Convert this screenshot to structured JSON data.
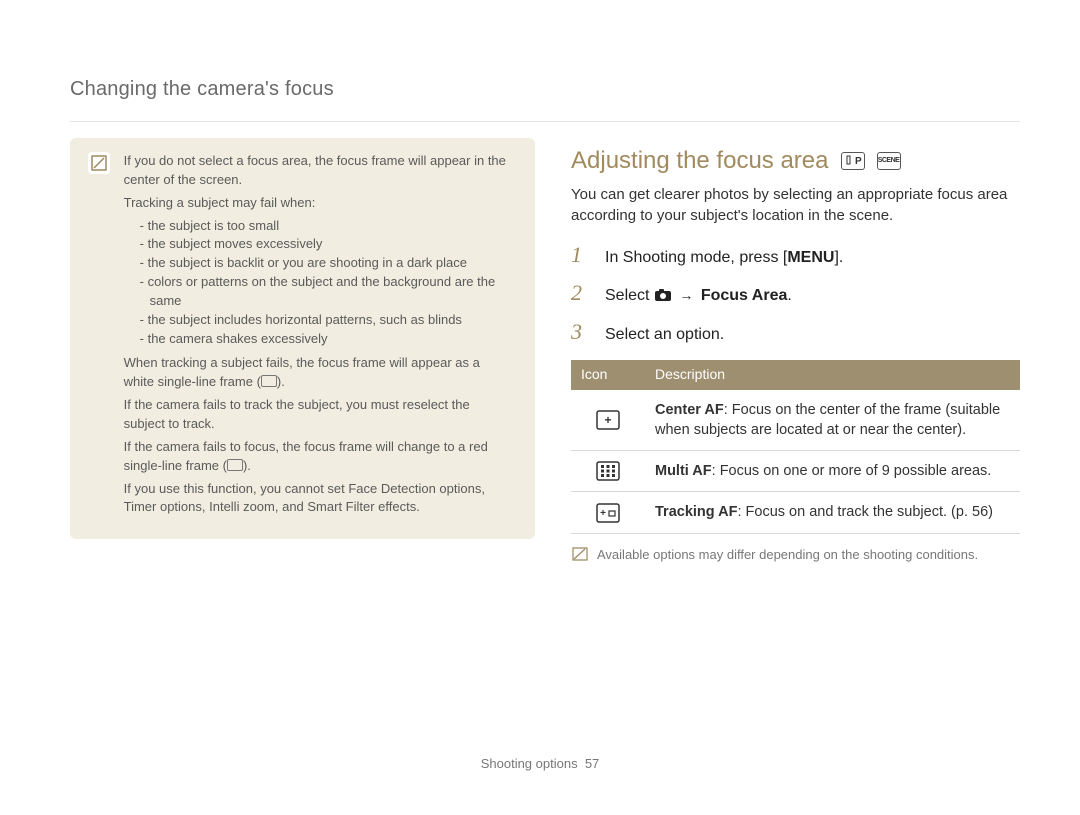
{
  "section_title": "Changing the camera's focus",
  "note": {
    "p1": "If you do not select a focus area, the focus frame will appear in the center of the screen.",
    "p2": "Tracking a subject may fail when:",
    "bullets": [
      "the subject is too small",
      "the subject moves excessively",
      "the subject is backlit or you are shooting in a dark place",
      "colors or patterns on the subject and the background are the same",
      "the subject includes horizontal patterns, such as blinds",
      "the camera shakes excessively"
    ],
    "p3a": "When tracking a subject fails, the focus frame will appear as a white single-line frame (",
    "p3b": ").",
    "p4": "If the camera fails to track the subject, you must reselect the subject to track.",
    "p5a": "If the camera fails to focus, the focus frame will change to a red single-line frame (",
    "p5b": ").",
    "p6": "If you use this function, you cannot set Face Detection options, Timer options, Intelli zoom, and Smart Filter effects."
  },
  "heading": "Adjusting the focus area",
  "mode_icons": [
    "P",
    "SCENE"
  ],
  "intro": "You can get clearer photos by selecting an appropriate focus area according to your subject's location in the scene.",
  "steps": [
    {
      "num": "1",
      "prefix": "In Shooting mode, press [",
      "key": "MENU",
      "suffix": "]."
    },
    {
      "num": "2",
      "prefix": "Select ",
      "arrow": "→",
      "bold": "Focus Area",
      "suffix": "."
    },
    {
      "num": "3",
      "text": "Select an option."
    }
  ],
  "table": {
    "headers": [
      "Icon",
      "Description"
    ],
    "rows": [
      {
        "icon": "center-af",
        "bold": "Center AF",
        "rest": ": Focus on the center of the frame (suitable when subjects are located at or near the center)."
      },
      {
        "icon": "multi-af",
        "bold": "Multi AF",
        "rest": ": Focus on one or more of 9 possible areas."
      },
      {
        "icon": "tracking-af",
        "bold": "Tracking AF",
        "rest": ": Focus on and track the subject. (p. 56)"
      }
    ]
  },
  "footnote": "Available options may differ depending on the shooting conditions.",
  "footer": {
    "label": "Shooting options",
    "page": "57"
  }
}
